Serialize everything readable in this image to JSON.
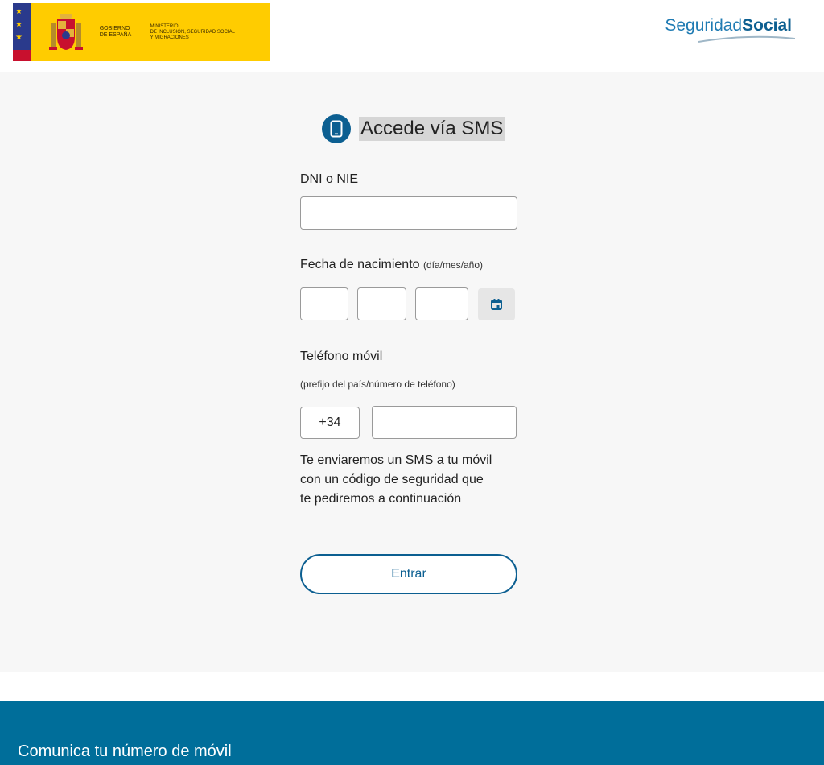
{
  "header": {
    "gov_line1": "GOBIERNO",
    "gov_line2": "DE ESPAÑA",
    "ministry_line1": "MINISTERIO",
    "ministry_line2": "DE INCLUSIÓN, SEGURIDAD SOCIAL",
    "ministry_line3": "Y MIGRACIONES",
    "brand_light": "Seguridad",
    "brand_bold": "Social"
  },
  "form": {
    "title": "Accede vía SMS",
    "title_icon": "smartphone-icon",
    "dni_label": "DNI o NIE",
    "dni_value": "",
    "birth_label": "Fecha de nacimiento",
    "birth_hint": "(día/mes/año)",
    "day_value": "",
    "month_value": "",
    "year_value": "",
    "calendar_icon": "calendar-icon",
    "phone_label": "Teléfono móvil",
    "phone_hint": "(prefijo del país/número de teléfono)",
    "prefix": "+34",
    "phone_value": "",
    "info_line1": "Te enviaremos un SMS a tu móvil",
    "info_line2": "con un código de seguridad que",
    "info_line3": "te pediremos a continuación",
    "submit_label": "Entrar"
  },
  "footer": {
    "text": "Comunica tu número de móvil"
  },
  "colors": {
    "primary": "#0c5f91",
    "footer": "#006e9a",
    "gov_yellow": "#ffcc00",
    "panel_bg": "#f7f7f7"
  }
}
